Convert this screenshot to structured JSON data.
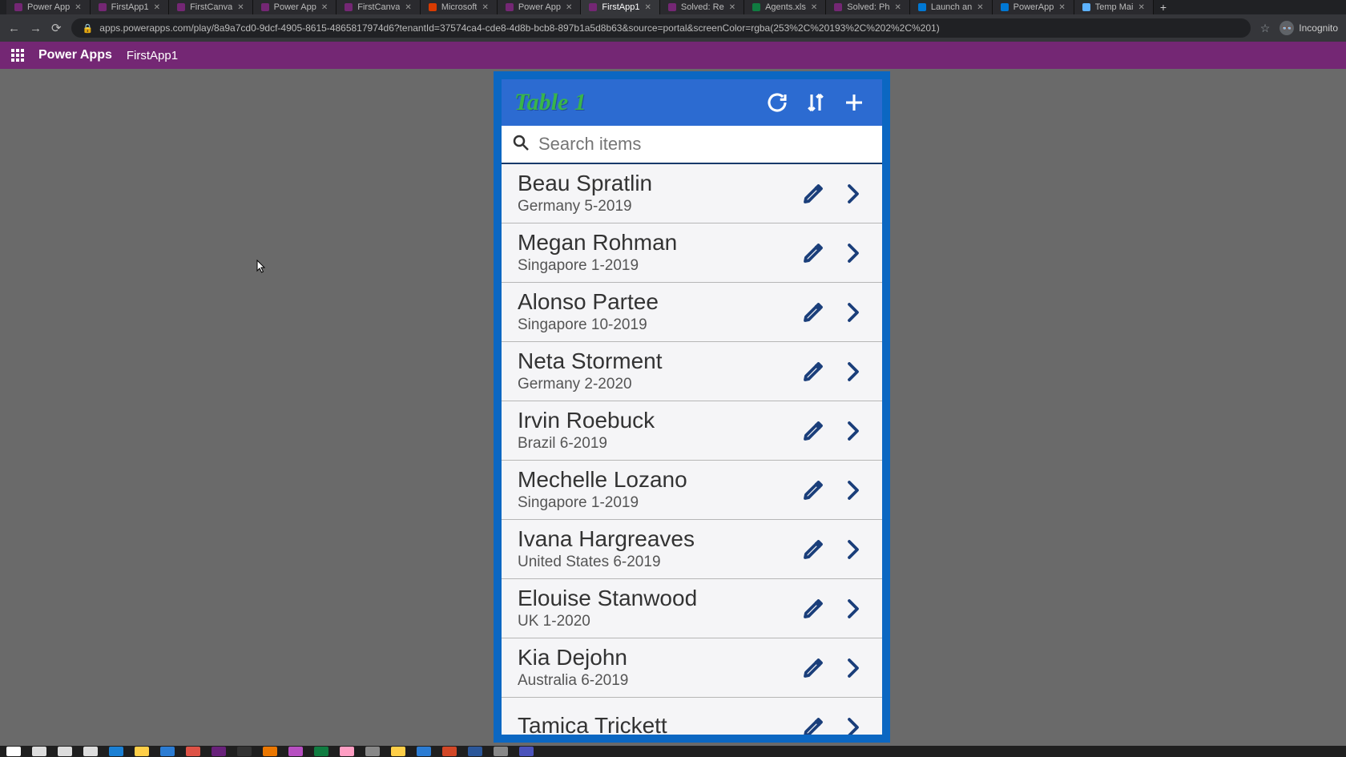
{
  "browser": {
    "tabs": [
      {
        "title": "Power App",
        "fav": "fav-pa"
      },
      {
        "title": "FirstApp1",
        "fav": "fav-pa"
      },
      {
        "title": "FirstCanva",
        "fav": "fav-pa"
      },
      {
        "title": "Power App",
        "fav": "fav-pa"
      },
      {
        "title": "FirstCanva",
        "fav": "fav-pa"
      },
      {
        "title": "Microsoft",
        "fav": "fav-ms"
      },
      {
        "title": "Power App",
        "fav": "fav-pa"
      },
      {
        "title": "FirstApp1",
        "fav": "fav-pa",
        "active": true
      },
      {
        "title": "Solved: Re",
        "fav": "fav-pa"
      },
      {
        "title": "Agents.xls",
        "fav": "fav-xl"
      },
      {
        "title": "Solved: Ph",
        "fav": "fav-pa"
      },
      {
        "title": "Launch an",
        "fav": "fav-az"
      },
      {
        "title": "PowerApp",
        "fav": "fav-az"
      },
      {
        "title": "Temp Mai",
        "fav": "fav-ml"
      }
    ],
    "url": "apps.powerapps.com/play/8a9a7cd0-9dcf-4905-8615-4865817974d6?tenantId=37574ca4-cde8-4d8b-bcb8-897b1a5d8b63&source=portal&screenColor=rgba(253%2C%20193%2C%202%2C%201)",
    "incognitoLabel": "Incognito"
  },
  "powerapps": {
    "brand": "Power Apps",
    "appName": "FirstApp1"
  },
  "app": {
    "title": "Table 1",
    "search": {
      "placeholder": "Search items"
    },
    "items": [
      {
        "name": "Beau Spratlin",
        "subtitle": "Germany 5-2019"
      },
      {
        "name": "Megan Rohman",
        "subtitle": "Singapore 1-2019"
      },
      {
        "name": "Alonso Partee",
        "subtitle": "Singapore 10-2019"
      },
      {
        "name": "Neta Storment",
        "subtitle": "Germany 2-2020"
      },
      {
        "name": "Irvin Roebuck",
        "subtitle": "Brazil 6-2019"
      },
      {
        "name": "Mechelle Lozano",
        "subtitle": "Singapore 1-2019"
      },
      {
        "name": "Ivana Hargreaves",
        "subtitle": "United States 6-2019"
      },
      {
        "name": "Elouise Stanwood",
        "subtitle": "UK 1-2020"
      },
      {
        "name": "Kia Dejohn",
        "subtitle": "Australia 6-2019"
      },
      {
        "name": "Tamica Trickett",
        "subtitle": ""
      }
    ]
  }
}
